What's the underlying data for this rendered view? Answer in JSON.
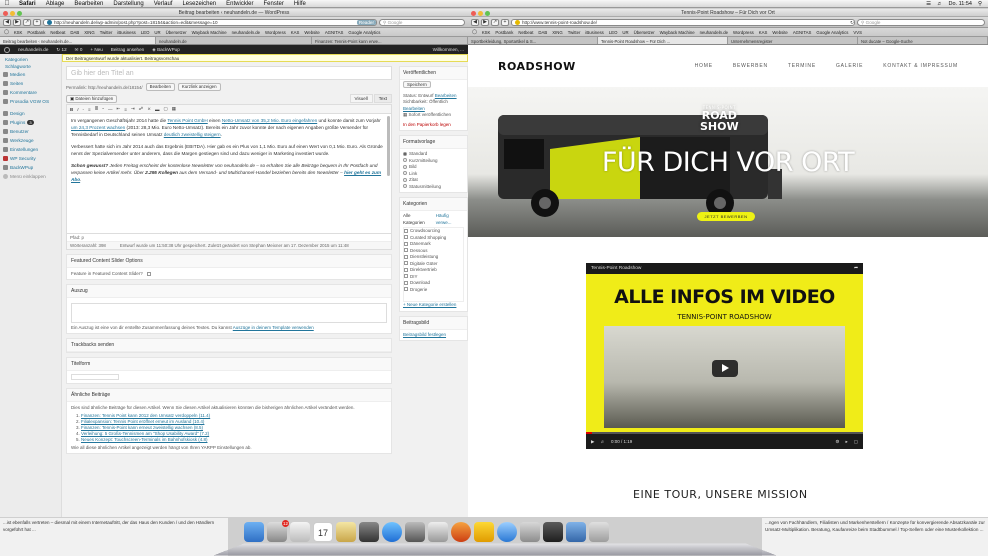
{
  "menubar": {
    "apple": "",
    "items": [
      "Safari",
      "Ablage",
      "Bearbeiten",
      "Darstellung",
      "Verlauf",
      "Lesezeichen",
      "Entwickler",
      "Fenster",
      "Hilfe"
    ],
    "clock": "Do. 11:54"
  },
  "wp_window": {
    "title": "Beitrag bearbeiten ‹ neuhandeln.de — WordPress",
    "url": "http://neuhandeln.de/wp-admin/post.php?post=18154&action=edit&message=10",
    "reader_label": "Reader",
    "search_placeholder": "Google",
    "bookmarks": [
      "KSK",
      "Postbank",
      "Netbeat",
      "DAB",
      "XING",
      "Twitter",
      "iBusiness",
      "LEO",
      "UR",
      "Übersetzer",
      "Wayback Machine",
      "neuhandeln.de",
      "Wordpress",
      "KAS",
      "Website",
      "AGNITAS",
      "Google Analytics"
    ],
    "tabs": [
      "Beitrag bearbeiten ‹ neuhandeln.de...",
      "neuhandeln.de",
      "Finanzen: Tennis-Point kann erwe..."
    ],
    "admin_bar": [
      "neuhandeln.de",
      "12",
      "0",
      "+ Neu",
      "Beitrag ansehen",
      "BackWPup"
    ],
    "admin_bar_right": "Willkommen, ...",
    "notice": "Der Beitragsentwurf wurde aktualisiert. Beitragsvorschau",
    "side_sub": [
      "Kategorien",
      "Schlagworte"
    ],
    "side_menu": [
      "Medien",
      "Seiten",
      "Kommentare",
      "Prosodia VGW OS",
      "Design",
      "Plugins",
      "Benutzer",
      "Werkzeuge",
      "Einstellungen",
      "WP Security",
      "BackWPup",
      "Menü einklappen"
    ],
    "plugins_badge": "3",
    "title_placeholder": "Gib hier den Titel an",
    "permalink_label": "Permalink: http://neuhandeln.de/18154/",
    "edit_button": "Bearbeiten",
    "shortlink_button": "Kurzlink anzeigen",
    "add_media": "Dateien hinzufügen",
    "visual_tab": "Visuell",
    "text_tab": "Text",
    "editor": {
      "p1_a": "Im vergangenen Geschäftsjahr 2014 hatte die ",
      "p1_link1": "Tennis Point GmbH",
      "p1_b": " einen ",
      "p1_link2": "Netto-Umsatz von 35,2 Mio. Euro eingefahren",
      "p1_c": " und konnte damit zum Vorjahr ",
      "p1_link3": "um 24,3 Prozent wachsen",
      "p1_d": " (2013: 28,3 Mio. Euro Netto-Umsatz). Bereits ein Jahr zuvor konnte der nach eigenen Angaben größte Versender für Tennisbedarf in Deutschland seinen Umsatz ",
      "p1_link4": "deutlich zweistellig steigern",
      "p1_e": ".",
      "p2": "Verbessert hatte sich im Jahr 2014 auch das Ergebnis (EBITDA). Hier gab es ein Plus von 1,1 Mio. Euro auf einen Wert von 0,1 Mio. Euro. Als Gründe nennt der Spezialversender unter anderem, dass die Margen gestiegen sind und dazu weniger in Marketing investiert wurde.",
      "p3_bold": "Schon gewusst?",
      "p3_a": " Jeden Freitag erscheint der kostenlose Newsletter von neuhandeln.de – so erhalten Sie alle Beiträge bequem in Ihr Postfach und verpassen keine Artikel mehr. Über ",
      "p3_bold2": "2.295 Kollegen",
      "p3_b": " aus dem Versand- und Multichannel-Handel beziehen bereits den Newsletter – ",
      "p3_link": "hier geht es zum Abo",
      "p3_c": "."
    },
    "path": "Pfad: p",
    "wordcount": "Wörteranzahl: 398",
    "last_edit": "Entwurf wurde um 11:50:38 Uhr gespeichert. Zuletzt geändert von Stephan Meixner am 17. Dezember 2015 um 11:48",
    "slider_box_title": "Featured Content Slider Options",
    "slider_feature_label": "Feature in Featured Content Slider?",
    "excerpt_title": "Auszug",
    "excerpt_help": "Ein Auszug ist eine von dir erstellte Zusammenfassung deines Textes. Du kannst ",
    "excerpt_help_link": "Auszüge in deinem Template verwenden",
    "trackbacks_title": "Trackbacks senden",
    "titelform_title": "Titelform",
    "related_title": "Ähnliche Beiträge",
    "related_intro": "Dies sind ähnliche Beiträge für diesen Artikel. Wenn Sie diesen Artikel aktualisieren könnten die bisherigen ähnlichen Artikel verändert werden.",
    "related_items": [
      "Finanzen: Tennis Point kann 2012 den Umsatz verdoppeln (11.4)",
      "Filialexpansion: Tennis Point eröffnet erneut im Ausland (10.4)",
      "Finanzen: Tennis-Point kann erneut zweistellig wachsen (8.5)",
      "Verleihung: 5 Großs-Tennismen am \"Shop Usability Award\" (7.2)",
      "Neues Konzept: Touchscreen-Terminals im Bahnhofskiosk (4.8)"
    ],
    "related_footer": "Wie all diese ähnlichen Artikel angezeigt werden hängt von Ihren YARPP Einstellungen ab.",
    "publish": {
      "title": "Veröffentlichen",
      "save_button": "Speichern",
      "status": "Status: Entwurf",
      "status_edit": "Bearbeiten",
      "visibility": "Sichtbarkeit: Öffentlich",
      "visibility_edit": "Bearbeiten",
      "schedule": "Sofort veröffentlichen",
      "trash": "In den Papierkorb legen"
    },
    "format": {
      "title": "Formatvorlage",
      "options": [
        "Standard",
        "Kurzmitteilung",
        "Bild",
        "Link",
        "Zitat",
        "Statusmitteilung"
      ]
    },
    "categories": {
      "title": "Kategorien",
      "tab_all": "Alle Kategorien",
      "tab_popular": "Häufig verwe...",
      "items": [
        "Crowdsourcing",
        "Curated Shopping",
        "Dänemark",
        "Dessous",
        "Dienstleistung",
        "Digitale Güter",
        "Direktvertrieb",
        "DIY",
        "Download",
        "Drogerie"
      ],
      "add_new": "+ Neue Kategorie erstellen"
    },
    "thumbnail": {
      "title": "Beitragsbild",
      "link": "Beitragsbild festlegen"
    }
  },
  "site_window": {
    "title": "Tennis-Point Roadshow – Für Dich vor Ort",
    "url": "http://www.tennis-point-roadshow.de/",
    "search_placeholder": "Google",
    "bookmarks": [
      "KSK",
      "Postbank",
      "Netbeat",
      "DAB",
      "XING",
      "Twitter",
      "iBusiness",
      "LEO",
      "UR",
      "Übersetzer",
      "Wayback Machine",
      "neuhandeln.de",
      "Wordpress",
      "KAS",
      "Website",
      "AGNITAS",
      "Google Analytics",
      "VVS"
    ],
    "tabs": [
      "Sportbekleidung, Sportartikel & S...",
      "Tennis-Point Roadshow – Für Dich ...",
      "Unternehmensregister",
      "Not ducate – Google-Suche"
    ],
    "logo": "ROADSHOW",
    "nav": [
      "HOME",
      "BEWERBEN",
      "TERMINE",
      "GALERIE",
      "KONTAKT & IMPRESSUM"
    ],
    "hero_small": "TENNIS-POINT",
    "hero_road1": "ROAD",
    "hero_road2": "SHOW",
    "hero_title": "FÜR DICH VOR ORT",
    "hero_button": "JETZT BEWERBEN",
    "video": {
      "top_title": "Tennis-Point Roadshow",
      "headline": "ALLE INFOS IM VIDEO",
      "sub": "TENNIS-POINT ROADSHOW",
      "time": "0:00 / 1:19",
      "progress": 0.02
    },
    "footer_heading": "EINE TOUR, UNSERE MISSION"
  },
  "dock": {
    "calendar_day": "17",
    "mail_badge": "12"
  },
  "bg_text_right": "...ngen von Fachhändlern, Filialisten und Markenherstellern / Konzepte für konvergierende Absatzkanäle zur Umsatz-Multiplikation. Beratung, Kaufanreize beim Stadtbummel / Top-Sellern oder eine Musterkollektion ...",
  "bg_text_left": "...ist ebenfalls vertreten – diesmal mit einem Internetauftritt, der das Haus den Kunden / und den Händlern vorgeführt hat ..."
}
